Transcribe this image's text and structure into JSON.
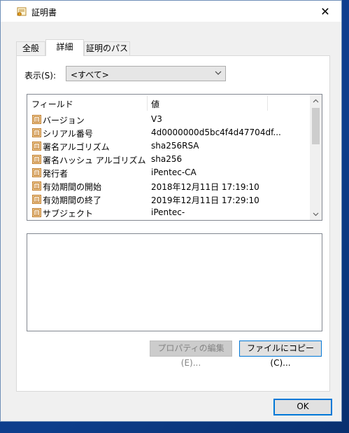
{
  "window": {
    "title": "証明書",
    "close_glyph": "✕"
  },
  "tabs": [
    {
      "label": "全般",
      "active": false
    },
    {
      "label": "詳細",
      "active": true
    },
    {
      "label": "証明のパス",
      "active": false
    }
  ],
  "show": {
    "label": "表示(S):",
    "selected": "<すべて>"
  },
  "list": {
    "columns": [
      "フィールド",
      "値"
    ],
    "rows": [
      {
        "field": "バージョン",
        "value": "V3"
      },
      {
        "field": "シリアル番号",
        "value": "4d0000000d5bc4f4d47704df..."
      },
      {
        "field": "署名アルゴリズム",
        "value": "sha256RSA"
      },
      {
        "field": "署名ハッシュ アルゴリズム",
        "value": "sha256"
      },
      {
        "field": "発行者",
        "value": "iPentec-CA"
      },
      {
        "field": "有効期間の開始",
        "value": "2018年12月11日 17:19:10"
      },
      {
        "field": "有効期間の終了",
        "value": "2019年12月11日 17:29:10"
      },
      {
        "field": "サブジェクト",
        "value": "iPentec-"
      }
    ]
  },
  "buttons": {
    "edit_properties": "プロパティの編集(E)...",
    "copy_to_file": "ファイルにコピー(C)...",
    "ok": "OK"
  },
  "colors": {
    "accent": "#0078d7",
    "icon_bg": "#f3d9a6",
    "icon_border": "#c07a2c"
  }
}
